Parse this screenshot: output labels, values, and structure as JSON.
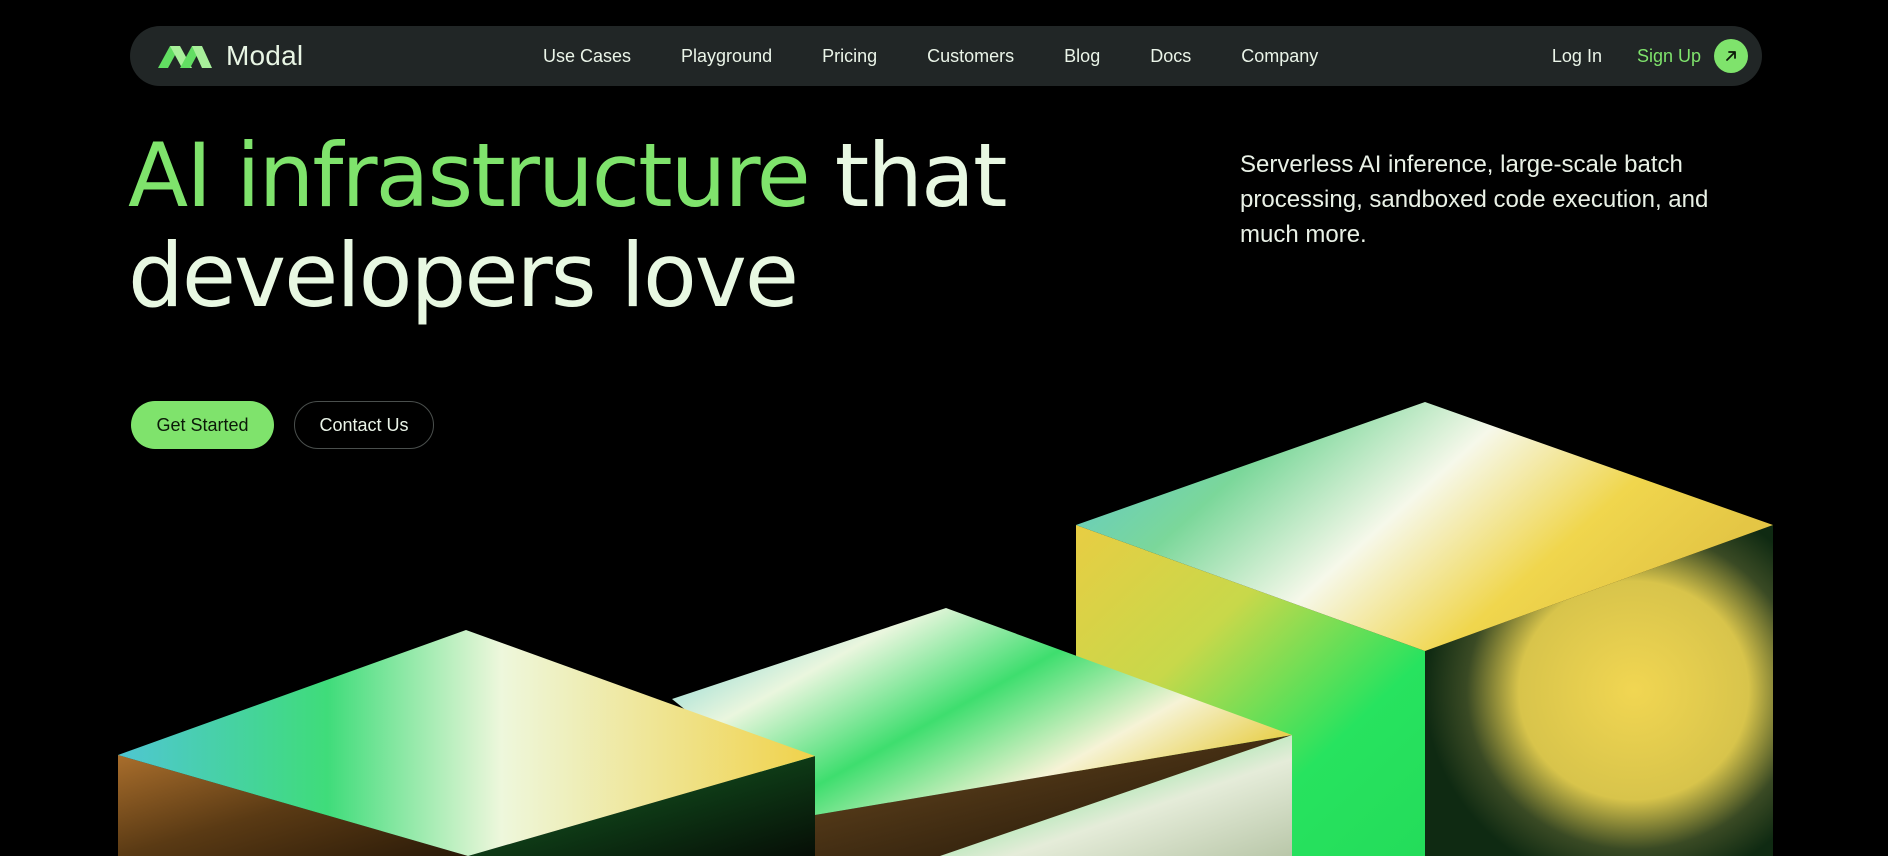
{
  "nav": {
    "brand": "Modal",
    "links": [
      "Use Cases",
      "Playground",
      "Pricing",
      "Customers",
      "Blog",
      "Docs",
      "Company"
    ],
    "login": "Log In",
    "signup": "Sign Up",
    "signup_icon": "arrow-up-right-icon"
  },
  "hero": {
    "headline_green": "AI infrastructure",
    "headline_rest_1": "that",
    "headline_rest_2": "developers love",
    "lead": "Serverless AI inference, large-scale batch processing, sandboxed code execution, and much more.",
    "primary_cta": "Get Started",
    "secondary_cta": "Contact Us"
  },
  "colors": {
    "accent": "#7fe36c",
    "background": "#000000",
    "nav_background": "#212626",
    "text": "#e8f8e2"
  },
  "illustration": "three-gradient-cubes"
}
